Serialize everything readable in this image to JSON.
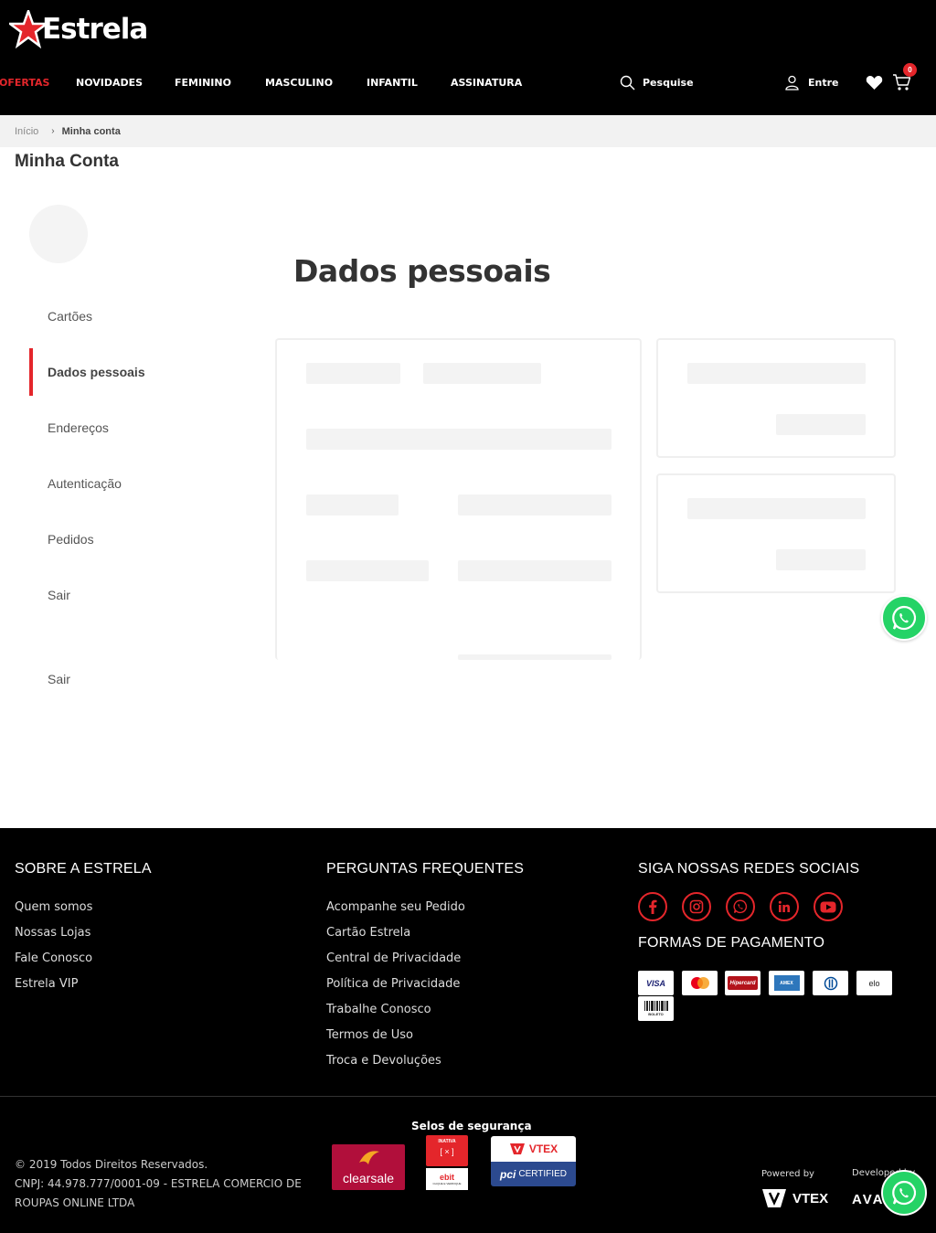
{
  "brand": {
    "name": "Estrela",
    "accent": "#e4262b"
  },
  "nav": {
    "items": [
      {
        "label": "OFERTAS",
        "hot": true
      },
      {
        "label": "NOVIDADES"
      },
      {
        "label": "FEMININO"
      },
      {
        "label": "MASCULINO"
      },
      {
        "label": "INFANTIL"
      },
      {
        "label": "ASSINATURA"
      }
    ],
    "search_label": "Pesquise",
    "login_label": "Entre",
    "cart_count": "0"
  },
  "breadcrumb": {
    "home": "Início",
    "current": "Minha conta"
  },
  "page_title": "Minha Conta",
  "sidebar": {
    "items": [
      {
        "label": "Cartões"
      },
      {
        "label": "Dados pessoais",
        "active": true
      },
      {
        "label": "Endereços"
      },
      {
        "label": "Autenticação"
      },
      {
        "label": "Pedidos"
      },
      {
        "label": "Sair"
      }
    ],
    "extra_logout": "Sair"
  },
  "main": {
    "title": "Dados pessoais"
  },
  "footer": {
    "about": {
      "title": "SOBRE A ESTRELA",
      "links": [
        "Quem somos",
        "Nossas Lojas",
        "Fale Conosco",
        "Estrela VIP"
      ]
    },
    "faq": {
      "title": "PERGUNTAS FREQUENTES",
      "links": [
        "Acompanhe seu Pedido",
        "Cartão Estrela",
        "Central de Privacidade",
        "Política de Privacidade",
        "Trabalhe Conosco",
        "Termos de Uso",
        "Troca e Devoluções"
      ]
    },
    "social": {
      "title": "SIGA NOSSAS REDES SOCIAIS",
      "icons": [
        "facebook-icon",
        "instagram-icon",
        "whatsapp-icon",
        "linkedin-icon",
        "youtube-icon"
      ]
    },
    "payment": {
      "title": "FORMAS DE PAGAMENTO",
      "methods": [
        "VISA",
        "Mastercard",
        "Hipercard",
        "Amex",
        "Diners",
        "elo",
        "BOLETO"
      ]
    },
    "selos_title": "Selos de segurança",
    "seals": {
      "clearsale": "clearsale",
      "ebit_status": "INATIVA",
      "ebit_name": "ebit",
      "ebit_sub": "CLIQUE E VERIFIQUE",
      "vtex": "VTEX",
      "pci": "CERTIFIED"
    },
    "copyright_line1": "© 2019 Todos Direitos Reservados.",
    "copyright_line2": "CNPJ: 44.978.777/0001-09 - ESTRELA COMERCIO DE ROUPAS ONLINE LTDA",
    "powered_by": "Powered by",
    "powered_brand": "VTEX",
    "developed_by": "Developed by",
    "developed_brand": "AVA"
  }
}
